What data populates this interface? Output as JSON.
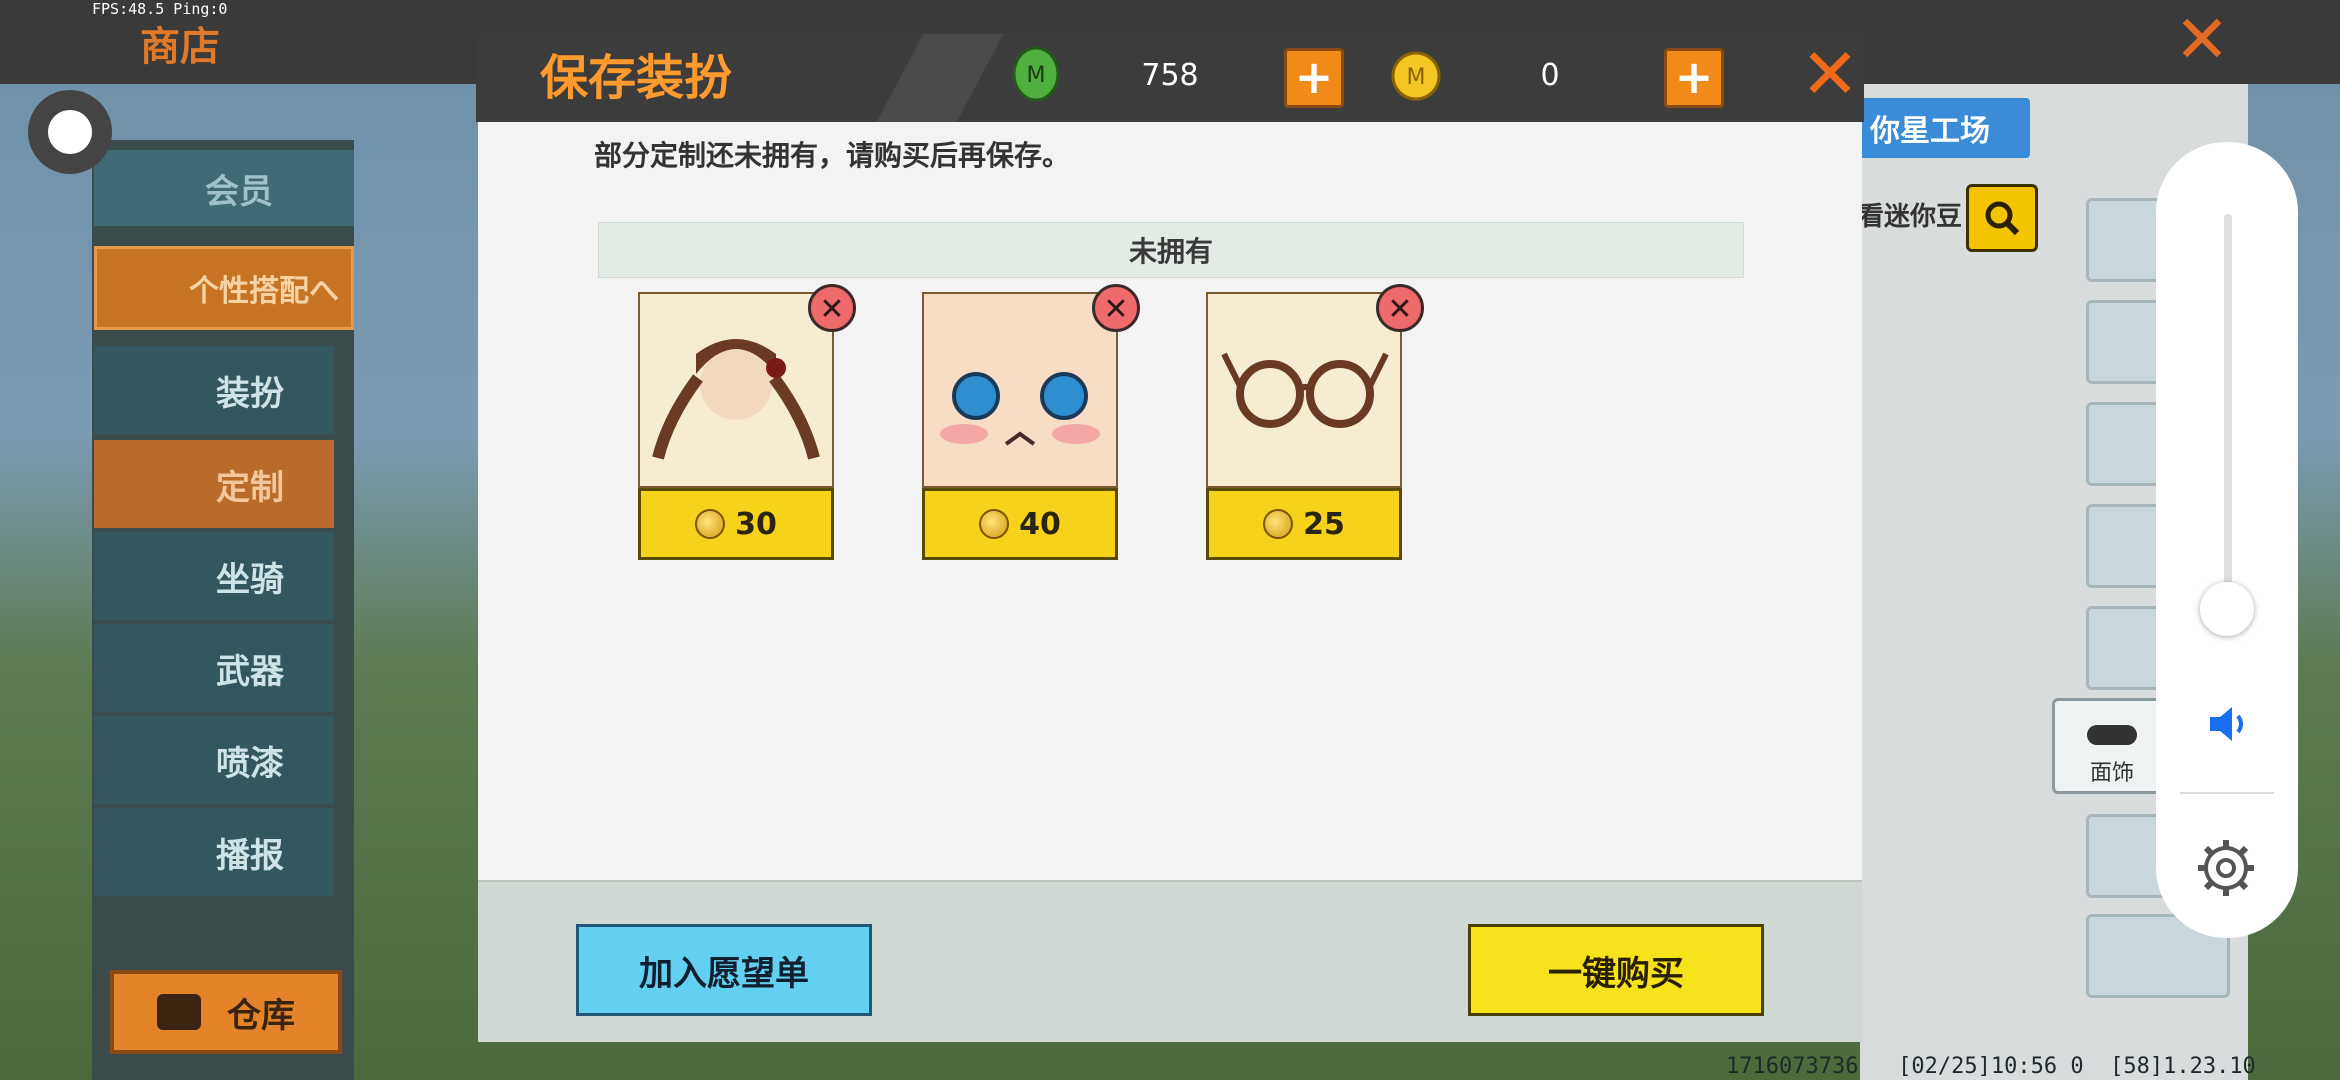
{
  "status": {
    "fps": "FPS:48.5  Ping:0"
  },
  "shop": {
    "title": "商店"
  },
  "sidebar": {
    "member": "会员",
    "personal": "个性搭配へ",
    "items": [
      {
        "label": "装扮"
      },
      {
        "label": "定制"
      },
      {
        "label": "坐骑"
      },
      {
        "label": "武器"
      },
      {
        "label": "喷漆"
      },
      {
        "label": "播报"
      }
    ],
    "warehouse": "仓库"
  },
  "right_panel": {
    "studio": "你星工场",
    "mini_bean": "看迷你豆",
    "mask_tab": "面饰"
  },
  "dialog": {
    "title": "保存装扮",
    "gems": "758",
    "coins": "0",
    "message": "部分定制还未拥有，请购买后再保存。",
    "section": "未拥有",
    "items": [
      {
        "name": "hair-braids",
        "price": "30"
      },
      {
        "name": "face-blush",
        "price": "40"
      },
      {
        "name": "round-glasses",
        "price": "25"
      }
    ],
    "wishlist_button": "加入愿望单",
    "buy_button": "一键购买"
  },
  "bottom_info": "1716073736   [02/25]10:56 0  [58]1.23.10",
  "colors": {
    "accent_orange": "#ff9a2e",
    "gold": "#f6d21a",
    "cyan": "#63d0f2"
  }
}
